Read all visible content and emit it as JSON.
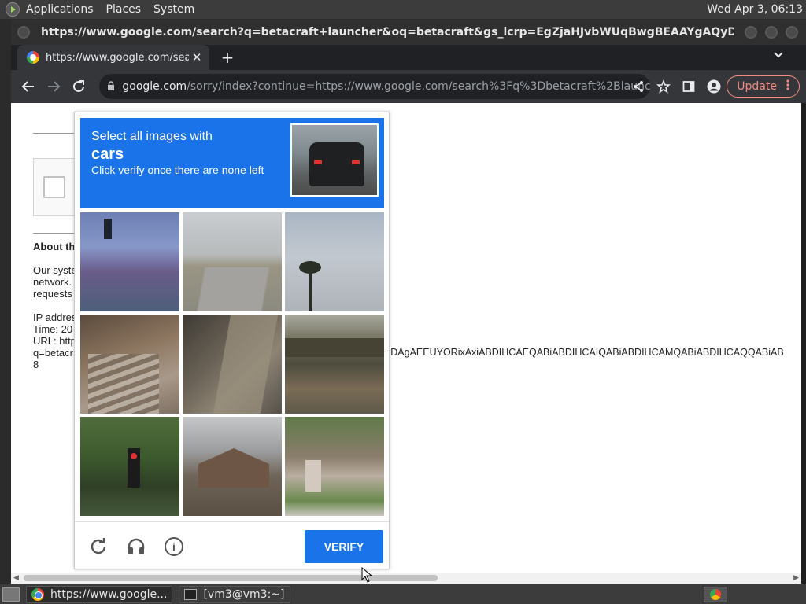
{
  "top_panel": {
    "menus": [
      "Applications",
      "Places",
      "System"
    ],
    "clock": "Wed Apr 3, 06:13"
  },
  "window": {
    "title": "https://www.google.com/search?q=betacraft+launcher&oq=betacraft&gs_lcrp=EgZjaHJvbWUqBwgBEAAYgAQyDAgAEEUYORixAxiABDIHC..."
  },
  "tab": {
    "title": "https://www.google.com/sear",
    "close": "✕",
    "new_tab": "+",
    "menu": "⌄"
  },
  "toolbar": {
    "omnibox_host": "google.com",
    "omnibox_path": "/sorry/index?continue=https://www.google.com/search%3Fq%3Dbetacraft%2Blaunc...",
    "update_label": "Update"
  },
  "page": {
    "about_heading": "About th",
    "body_lines": [
      "Our syste",
      "network.",
      "requests"
    ],
    "ip_lines": [
      "IP addres",
      "Time: 20",
      "URL: http",
      "q=betacr",
      "8"
    ],
    "long_url_tail": "yDAgAEEUYORixAxiABDIHCAEQABiABDIHCAIQABiABDIHCAMQABiABDIHCAQQABiAB"
  },
  "captcha": {
    "instruction_line1": "Select all images with",
    "target_object": "cars",
    "instruction_line3": "Click verify once there are none left",
    "verify_label": "VERIFY",
    "tiles": [
      "tile-1",
      "tile-2",
      "tile-3",
      "tile-4",
      "tile-5",
      "tile-6",
      "tile-7",
      "tile-8",
      "tile-9"
    ]
  },
  "taskbar": {
    "tasks": [
      "https://www.google...",
      "[vm3@vm3:~]"
    ]
  },
  "colors": {
    "captcha_blue": "#1a73e8",
    "update_red": "#f28b82"
  }
}
